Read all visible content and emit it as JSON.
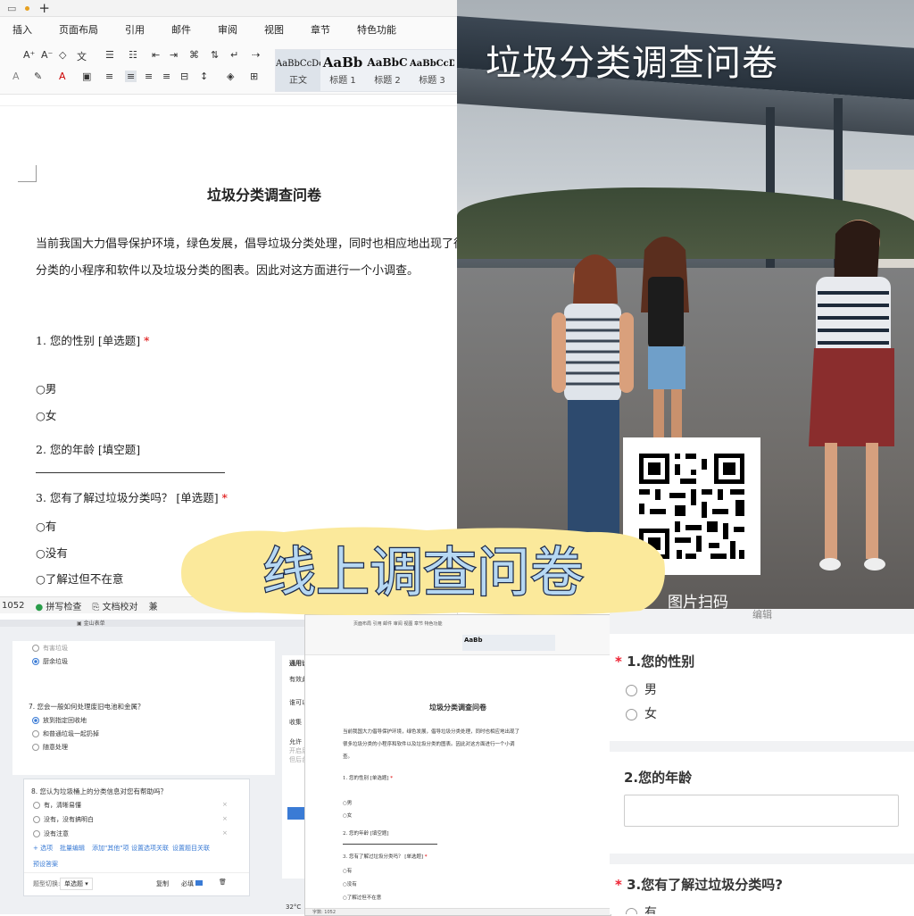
{
  "doc1": {
    "menu": [
      "插入",
      "页面布局",
      "引用",
      "邮件",
      "审阅",
      "视图",
      "章节",
      "特色功能"
    ],
    "styles": [
      {
        "sample": "AaBbCcDd",
        "label": "正文"
      },
      {
        "sample": "AaBb",
        "label": "标题 1"
      },
      {
        "sample": "AaBbC",
        "label": "标题 2"
      },
      {
        "sample": "AaBbCcD",
        "label": "标题 3"
      }
    ],
    "title": "垃圾分类调查问卷",
    "para": "当前我国大力倡导保护环境，绿色发展，倡导垃圾分类处理，同时也相应地出现了很多垃圾分类的小程序和软件以及垃圾分类的图表。因此对这方面进行一个小调查。",
    "q1": "1. 您的性别 [单选题]",
    "q1_opts": [
      "○男",
      "○女"
    ],
    "q2": "2. 您的年龄 [填空题]",
    "q3": "3. 您有了解过垃圾分类吗？ [单选题]",
    "q3_opts": [
      "○有",
      "○没有",
      "○了解过但不在意"
    ],
    "status": {
      "count": "1052",
      "spell": "拼写检查",
      "check": "文档校对",
      "compat": "兼"
    }
  },
  "photo": {
    "title": "垃圾分类调查问卷",
    "scan": "图片扫码"
  },
  "sticker": {
    "text": "线上调查问卷",
    "color": "#fbe99b",
    "stroke": "#1c2a4a"
  },
  "editor": {
    "opt_top1": "有害垃圾",
    "opt_top2": "厨余垃圾",
    "q7": "7. 您会一般如何处理废旧电池和金属？",
    "q7_opts": [
      "放到指定回收地",
      "和普通垃圾一起扔掉",
      "随意处理"
    ],
    "q8": "8. 您认为垃圾桶上的分类信息对您有帮助吗？",
    "q8_opts": [
      "有，清晰易懂",
      "没有，没有搞明白",
      "没有注意"
    ],
    "actions": [
      "+ 选项",
      "批量编辑",
      "添加\"其他\"项",
      "设置选项关联",
      "设置题目关联"
    ],
    "answer": "预设答案",
    "type_label": "题型切换:",
    "type_value": "单选题",
    "copy": "复制",
    "required": "必填",
    "side_title": "通用设",
    "side_items": [
      "有效此",
      "谁可以",
      "收集",
      "允许",
      "开启后",
      "但后台"
    ],
    "temp": "32°C"
  },
  "doc2": {
    "title": "垃圾分类调查问卷",
    "para1": "当前我国大力倡导保护环境，绿色发展，倡导垃圾分类处理，同时也相应地出现了",
    "para2": "很多垃圾分类的小程序和软件以及垃圾分类的图表。因此对这方面进行一个小调",
    "para3": "查。",
    "q1": "1. 您的性别 [单选题]",
    "q1_opts": [
      "○男",
      "○女"
    ],
    "q2": "2. 您的年龄 [填空题]",
    "q3": "3. 您有了解过垃圾分类吗？ [单选题]",
    "q3_opts": [
      "○有",
      "○没有",
      "○了解过但不在意"
    ],
    "status": "字数: 1052"
  },
  "mobile": {
    "top_label": "编辑",
    "q1": "1.您的性别",
    "q1_opts": [
      "男",
      "女"
    ],
    "q2": "2.您的年龄",
    "q3": "3.您有了解过垃圾分类吗?",
    "q3_opts": [
      "有"
    ]
  }
}
